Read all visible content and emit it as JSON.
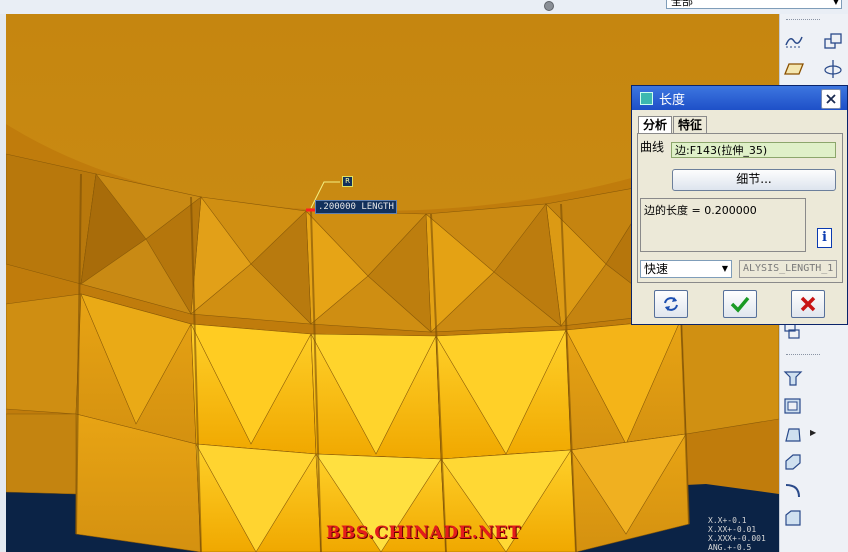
{
  "top": {
    "filter_value": "全部"
  },
  "dialog": {
    "title": "长度",
    "tabs": [
      {
        "label": "分析"
      },
      {
        "label": "特征"
      }
    ],
    "curve_label": "曲线",
    "curve_value": "边:F143(拉伸_35)",
    "detail_button": "细节...",
    "result_text": "边的长度 = 0.200000",
    "mode_value": "快速",
    "feature_name": "ALYSIS_LENGTH_1",
    "info_glyph": "i"
  },
  "viewport": {
    "dimension_label": ".200000 LENGTH",
    "dimension_tag": "R",
    "watermark": "BBS.CHINADE.NET",
    "tolerance_lines": [
      "X.X+-0.1",
      "X.XX+-0.01",
      "X.XXX+-0.001",
      "ANG.+-0.5"
    ]
  },
  "colors": {
    "model": "#c7850f",
    "background": "#0b2346",
    "title_bar": "#2456d0",
    "ok_green": "#1a9a24",
    "cancel_red": "#c81414"
  }
}
